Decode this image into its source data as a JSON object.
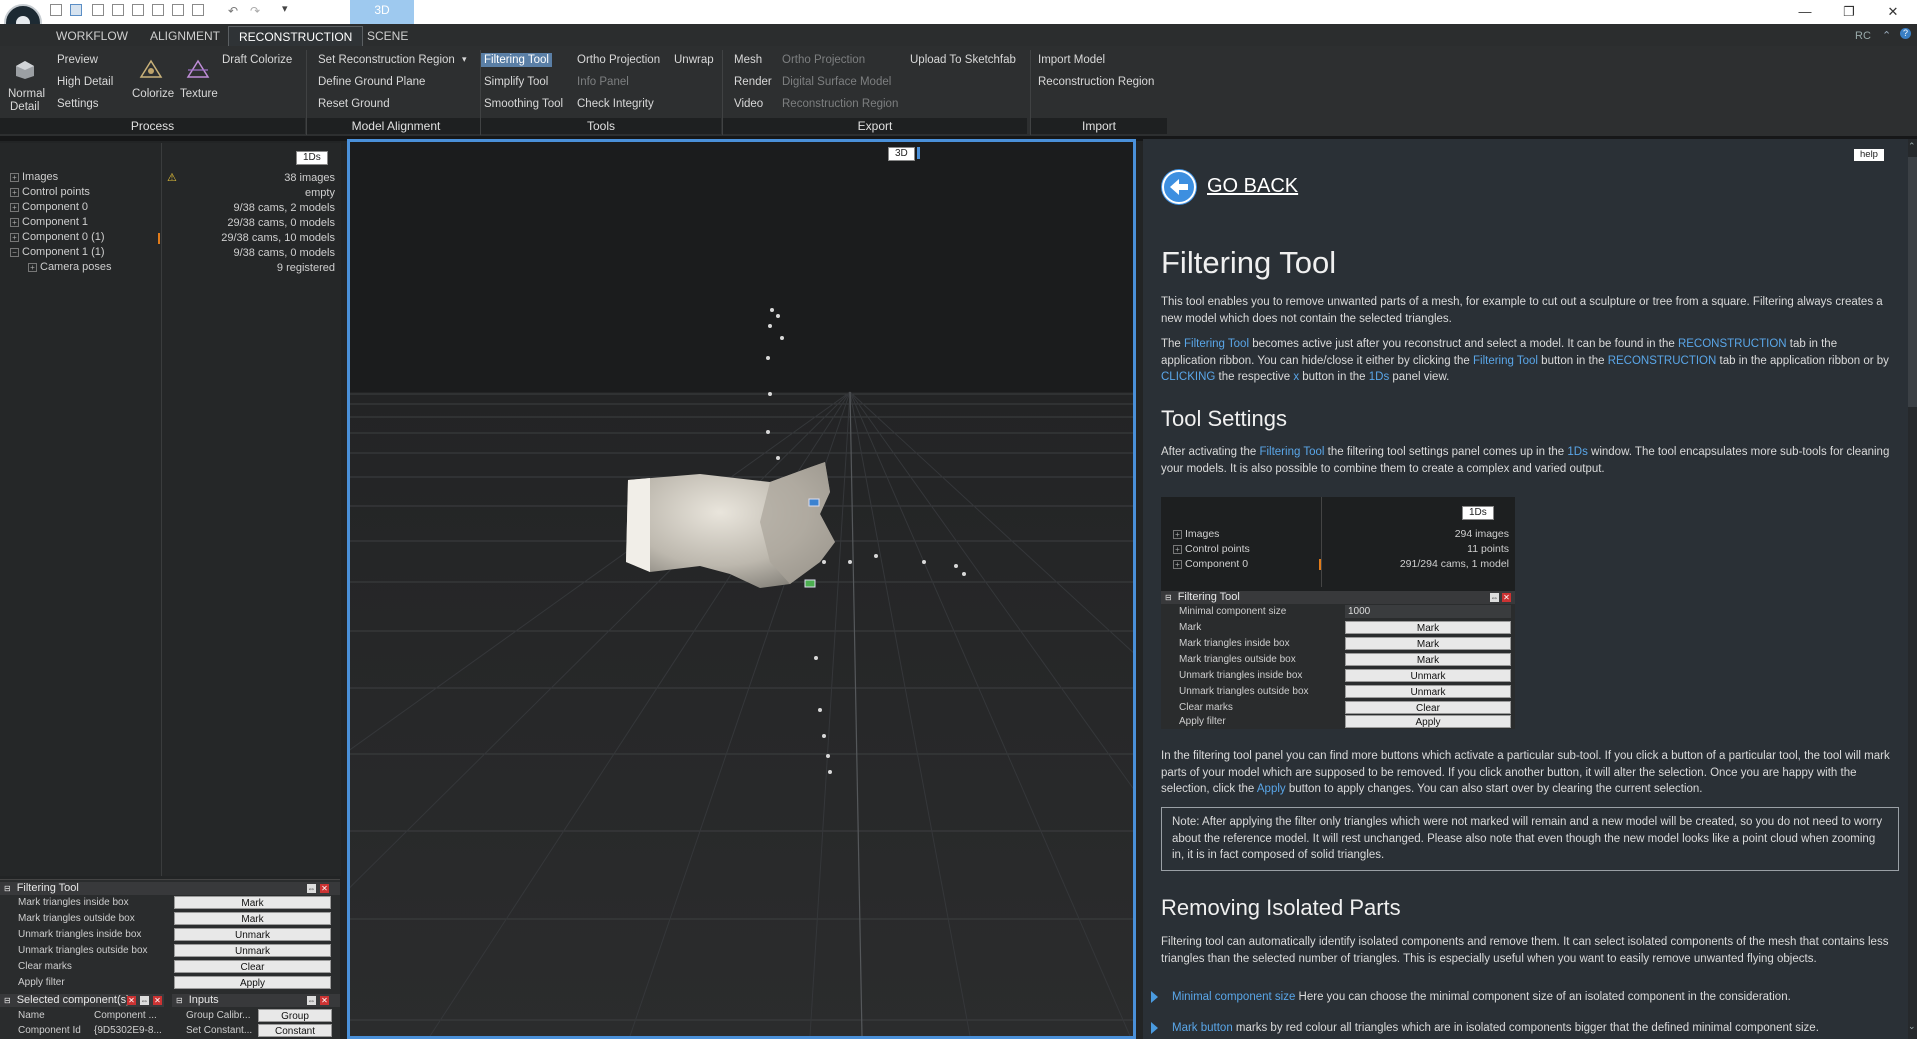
{
  "titlebar": {
    "tab_3d": "3D",
    "right_label": "RC"
  },
  "tabs": [
    "WORKFLOW",
    "ALIGNMENT",
    "RECONSTRUCTION",
    "SCENE"
  ],
  "ribbon": {
    "process": {
      "big_normal": "Normal",
      "big_detail": "Detail",
      "items": [
        "Preview",
        "High Detail",
        "Settings"
      ],
      "colorize": "Colorize",
      "texture": "Texture",
      "draft": "Draft Colorize",
      "label": "Process"
    },
    "model_alignment": {
      "items": [
        "Set Reconstruction Region",
        "Define Ground Plane",
        "Reset Ground"
      ],
      "label": "Model Alignment"
    },
    "tools": {
      "col1": [
        "Filtering Tool",
        "Simplify Tool",
        "Smoothing Tool"
      ],
      "col2": [
        "Ortho Projection",
        "Info Panel",
        "Check Integrity"
      ],
      "unwrap": "Unwrap",
      "label": "Tools"
    },
    "export": {
      "col1": [
        "Mesh",
        "Render",
        "Video"
      ],
      "col2": [
        "Ortho Projection",
        "Digital Surface Model",
        "Reconstruction Region"
      ],
      "upload": "Upload To Sketchfab",
      "label": "Export"
    },
    "import": {
      "items": [
        "Import Model",
        "Reconstruction Region"
      ],
      "label": "Import"
    }
  },
  "left_panel": {
    "badge": "1Ds",
    "tree": [
      {
        "label": "Images",
        "value": "38 images"
      },
      {
        "label": "Control points",
        "value": "empty"
      },
      {
        "label": "Component 0",
        "value": "9/38 cams, 2 models"
      },
      {
        "label": "Component 1",
        "value": "29/38 cams, 0 models"
      },
      {
        "label": "Component 0 (1)",
        "value": "29/38 cams, 10 models"
      },
      {
        "label": "Component 1 (1)",
        "value": "9/38 cams, 0 models"
      },
      {
        "label": "Camera poses",
        "value": "9 registered"
      }
    ]
  },
  "filter_panel": {
    "title": "Filtering Tool",
    "rows": [
      {
        "label": "Mark triangles inside box",
        "button": "Mark"
      },
      {
        "label": "Mark triangles outside box",
        "button": "Mark"
      },
      {
        "label": "Unmark triangles inside box",
        "button": "Unmark"
      },
      {
        "label": "Unmark triangles outside box",
        "button": "Unmark"
      },
      {
        "label": "Clear marks",
        "button": "Clear"
      },
      {
        "label": "Apply filter",
        "button": "Apply"
      }
    ]
  },
  "selected_panel": {
    "title": "Selected component(s)",
    "col1": "Name",
    "col2": "Component ...",
    "id_label": "Component Id",
    "id_value": "{9D5302E9-8..."
  },
  "inputs_panel": {
    "title": "Inputs",
    "rows": [
      {
        "label": "Group Calibr...",
        "button": "Group"
      },
      {
        "label": "Set Constant...",
        "button": "Constant"
      }
    ]
  },
  "viewport": {
    "badge": "3D"
  },
  "help": {
    "help_button": "help",
    "go_back": "GO BACK",
    "title": "Filtering Tool",
    "intro": "This tool enables you to remove unwanted parts of a mesh, for example to cut out a sculpture or tree from a square. Filtering always creates a new model which does not contain the selected triangles.",
    "p2_a": "The ",
    "p2_link1": "Filtering Tool",
    "p2_b": " becomes active just after you reconstruct and select a model. It can be found in the ",
    "p2_link2": "RECONSTRUCTION",
    "p2_c": " tab in the application ribbon. You can hide/close it either by clicking the ",
    "p2_link3": "Filtering Tool",
    "p2_d": " button in the ",
    "p2_link4": "RECONSTRUCTION",
    "p2_e": " tab in the application ribbon or by ",
    "p2_link5": "CLICKING",
    "p2_f": " the respective ",
    "p2_link6": "x",
    "p2_g": " button in the ",
    "p2_link7": "1Ds",
    "p2_h": " panel view.",
    "settings_title": "Tool Settings",
    "p3_a": "After activating the ",
    "p3_link1": "Filtering Tool",
    "p3_b": " the filtering tool settings panel comes up in the ",
    "p3_link2": "1Ds",
    "p3_c": " window. The tool encapsulates more sub-tools for cleaning your models. It is also possible to combine them to create a complex and varied output.",
    "shot": {
      "badge": "1Ds",
      "tree": [
        {
          "label": "Images",
          "value": "294 images"
        },
        {
          "label": "Control points",
          "value": "11 points"
        },
        {
          "label": "Component 0",
          "value": "291/294 cams, 1 model"
        }
      ],
      "panel_title": "Filtering Tool",
      "min_label": "Minimal component size",
      "min_value": "1000",
      "rows": [
        {
          "label": "Mark",
          "button": "Mark"
        },
        {
          "label": "Mark triangles inside box",
          "button": "Mark"
        },
        {
          "label": "Mark triangles outside box",
          "button": "Mark"
        },
        {
          "label": "Unmark triangles inside box",
          "button": "Unmark"
        },
        {
          "label": "Unmark triangles outside box",
          "button": "Unmark"
        },
        {
          "label": "Clear marks",
          "button": "Clear"
        },
        {
          "label": "Apply filter",
          "button": "Apply"
        }
      ]
    },
    "p4_a": "In the filtering tool panel you can find more buttons which activate a particular sub-tool. If you click a button of a particular tool, the tool will mark parts of your model which are supposed to be removed. If you click another button, it will alter the selection. Once you are happy with the selection, click the ",
    "p4_link": "Apply",
    "p4_b": " button to apply changes. You can also start over by clearing the current selection.",
    "note": "Note: After applying the filter only triangles which were not marked will remain and a new model will be created, so you do not need to worry about the reference model. It will rest unchanged. Please also note that even though the new model looks like a point cloud when zooming in, it is in fact composed of solid triangles.",
    "isolated_title": "Removing Isolated Parts",
    "p5": "Filtering tool can automatically identify isolated components and remove them. It can select isolated components of the mesh that contains less triangles than the selected number of triangles. This is especially useful when you want to easily remove unwanted flying objects.",
    "b1_link": "Minimal component size",
    "b1_text": " Here you can choose the minimal component size of an isolated component in the consideration.",
    "b2_link": "Mark button",
    "b2_text": " marks by red colour all triangles which are in isolated components bigger that the defined minimal component size."
  }
}
